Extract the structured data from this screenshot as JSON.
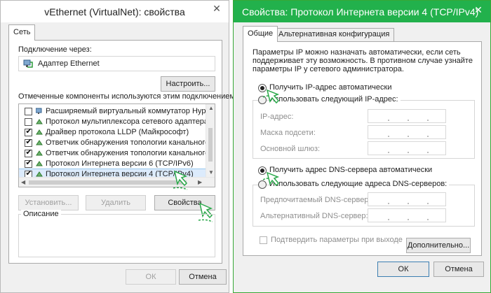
{
  "left_window": {
    "title": "vEthernet (VirtualNet): свойства",
    "tab": "Сеть",
    "connect_via_label": "Подключение через:",
    "adapter_name": "Адаптер Ethernet",
    "configure_button": "Настроить...",
    "components_label": "Отмеченные компоненты используются этим подключением:",
    "components": [
      {
        "label": "Расширяемый виртуальный коммутатор Hyper-V",
        "checked": false,
        "selected": false
      },
      {
        "label": "Протокол мультиплексора сетевого адаптера (Май",
        "checked": false,
        "selected": false
      },
      {
        "label": "Драйвер протокола LLDP (Майкрософт)",
        "checked": true,
        "selected": false
      },
      {
        "label": "Ответчик обнаружения топологии канального урове",
        "checked": true,
        "selected": false
      },
      {
        "label": "Ответчик обнаружения топологии канального урове",
        "checked": true,
        "selected": false
      },
      {
        "label": "Протокол Интернета версии 6 (TCP/IPv6)",
        "checked": true,
        "selected": false
      },
      {
        "label": "Протокол Интернета версии 4 (TCP/IPv4)",
        "checked": true,
        "selected": true
      }
    ],
    "install_button": "Установить...",
    "remove_button": "Удалить",
    "properties_button": "Свойства",
    "description_label": "Описание",
    "ok_button": "ОК",
    "cancel_button": "Отмена"
  },
  "right_window": {
    "title": "Свойства: Протокол Интернета версии 4 (TCP/IPv4)",
    "tabs": [
      "Общие",
      "Альтернативная конфигурация"
    ],
    "info_text": [
      "Параметры IP можно назначать автоматически, если сеть",
      "поддерживает эту возможность. В противном случае узнайте",
      "параметры IP у сетевого администратора."
    ],
    "auto_ip": "Получить IP-адрес автоматически",
    "manual_ip": "Использовать следующий IP-адрес:",
    "ip_address_label": "IP-адрес:",
    "subnet_mask_label": "Маска подсети:",
    "gateway_label": "Основной шлюз:",
    "auto_dns": "Получить адрес DNS-сервера автоматически",
    "manual_dns": "Использовать следующие адреса DNS-серверов:",
    "preferred_dns_label": "Предпочитаемый DNS-сервер:",
    "alternate_dns_label": "Альтернативный DNS-сервер:",
    "validate_label": "Подтвердить параметры при выходе",
    "advanced_button": "Дополнительно...",
    "ok_button": "ОК",
    "cancel_button": "Отмена"
  },
  "colors": {
    "accent_title": "#22b14c",
    "cursor_green": "#2aa84a"
  }
}
